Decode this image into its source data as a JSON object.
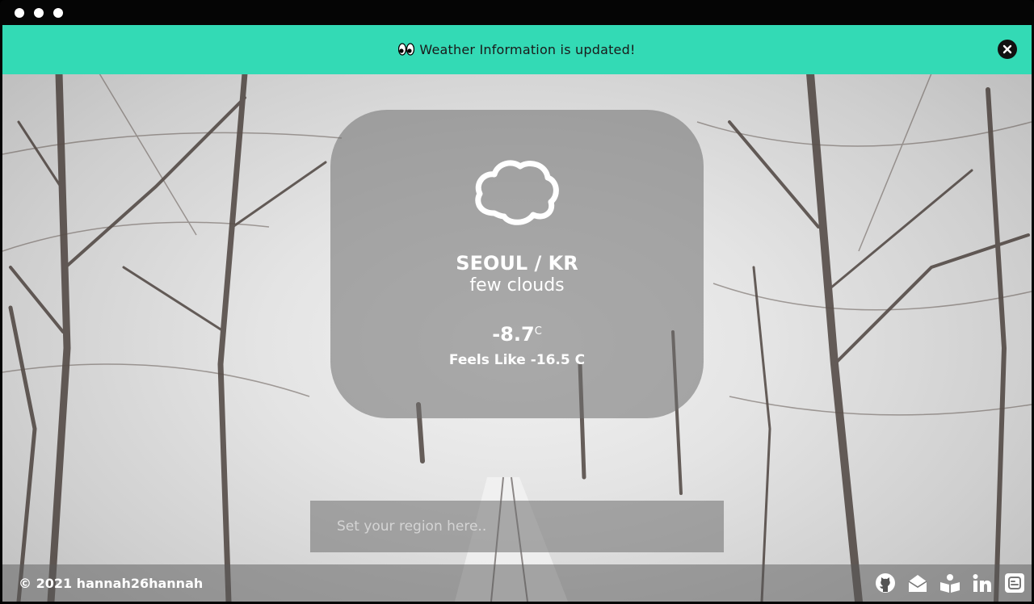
{
  "banner": {
    "message": "Weather Information is updated!",
    "icon": "eyes-icon",
    "close_icon": "close-icon",
    "color": "#33dab5"
  },
  "weather": {
    "icon": "cloud-icon",
    "location": "SEOUL / KR",
    "description": "few clouds",
    "temperature": "-8.7",
    "temperature_unit": "C",
    "feels_like": "Feels Like -16.5  C"
  },
  "search": {
    "placeholder": "Set your region here.."
  },
  "footer": {
    "copyright": "© 2021 hannah26hannah",
    "links": [
      "github-icon",
      "mail-icon",
      "blog-reader-icon",
      "linkedin-icon",
      "blogger-icon"
    ]
  }
}
